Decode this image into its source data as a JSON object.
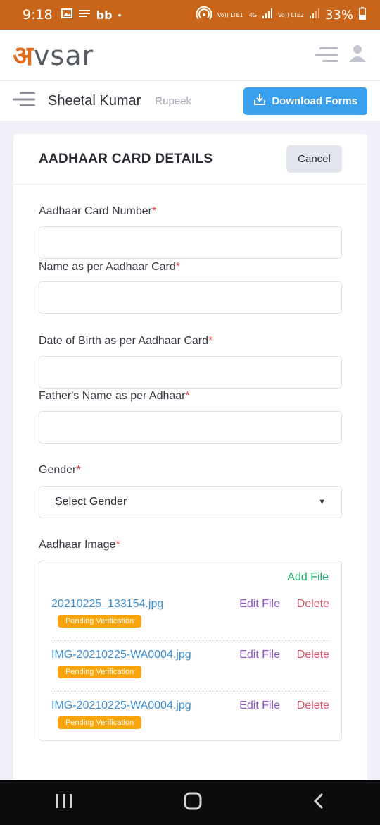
{
  "status_bar": {
    "time": "9:18",
    "network_left": "Vo)) LTE1",
    "network_4g": "4G",
    "network_right": "Vo)) LTE2",
    "battery": "33%"
  },
  "header": {
    "logo_accent": "अ",
    "logo_rest": "vsar"
  },
  "subheader": {
    "user_name": "Sheetal Kumar",
    "company": "Rupeek",
    "download_label": "Download Forms"
  },
  "form": {
    "title": "AADHAAR CARD DETAILS",
    "cancel_label": "Cancel",
    "required_mark": "*",
    "fields": {
      "aadhaar_number": {
        "label": "Aadhaar Card Number",
        "value": ""
      },
      "name": {
        "label": "Name as per Aadhaar Card",
        "value": ""
      },
      "dob": {
        "label": "Date of Birth as per Aadhaar Card",
        "value": ""
      },
      "father_name": {
        "label": "Father's Name as per Adhaar",
        "value": ""
      },
      "gender": {
        "label": "Gender",
        "selected": "Select Gender"
      },
      "image": {
        "label": "Aadhaar Image"
      }
    },
    "add_file_label": "Add File",
    "files": [
      {
        "name": "20210225_133154.jpg",
        "edit": "Edit File",
        "delete": "Delete",
        "status": "Pending Verification"
      },
      {
        "name": "IMG-20210225-WA0004.jpg",
        "edit": "Edit File",
        "delete": "Delete",
        "status": "Pending Verification"
      },
      {
        "name": "IMG-20210225-WA0004.jpg",
        "edit": "Edit File",
        "delete": "Delete",
        "status": "Pending Verification"
      }
    ]
  },
  "colors": {
    "status_bar": "#c8651b",
    "primary_button": "#3aa0f0",
    "add_file": "#1fb06a",
    "edit": "#8a54c9",
    "delete": "#e0556b",
    "badge": "#f9a60e"
  }
}
